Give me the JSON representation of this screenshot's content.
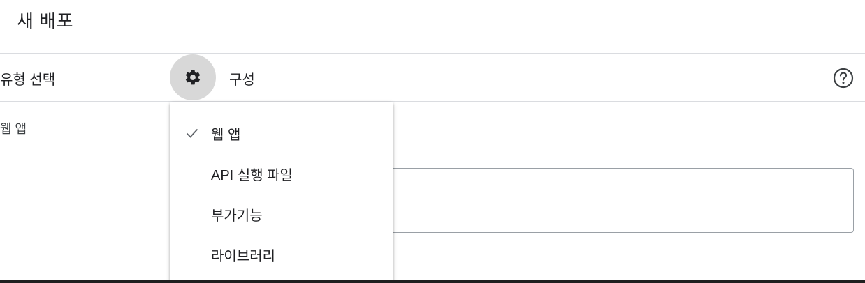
{
  "dialog": {
    "title": "새 배포"
  },
  "left_panel": {
    "heading": "유형 선택",
    "selected_type": "웹 앱",
    "settings_icon": "gear-icon"
  },
  "right_panel": {
    "heading": "구성",
    "help_icon": "help-circle-icon"
  },
  "type_menu": {
    "items": [
      {
        "label": "웹 앱",
        "checked": true
      },
      {
        "label": "API 실행 파일",
        "checked": false
      },
      {
        "label": "부가기능",
        "checked": false
      },
      {
        "label": "라이브러리",
        "checked": false
      }
    ]
  },
  "colors": {
    "gear_button_bg": "#d8d8d8",
    "divider": "#dadce0",
    "text": "#202124"
  }
}
